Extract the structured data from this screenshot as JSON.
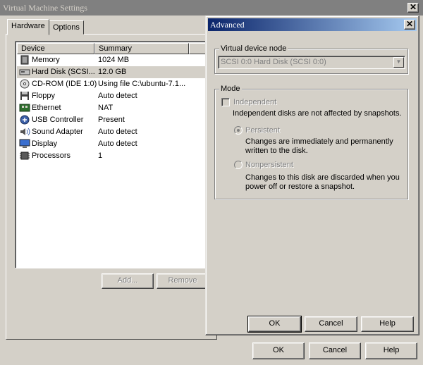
{
  "main_window": {
    "title": "Virtual Machine Settings",
    "close_glyph": "✕",
    "tabs": [
      {
        "label": "Hardware",
        "active": true
      },
      {
        "label": "Options",
        "active": false
      }
    ],
    "list": {
      "columns": [
        "Device",
        "Summary"
      ],
      "rows": [
        {
          "device": "Memory",
          "summary": "1024 MB",
          "icon": "memory-icon",
          "selected": false
        },
        {
          "device": "Hard Disk (SCSI...",
          "summary": "12.0 GB",
          "icon": "hard-disk-icon",
          "selected": true
        },
        {
          "device": "CD-ROM (IDE 1:0)",
          "summary": "Using file C:\\ubuntu-7.1...",
          "icon": "cd-rom-icon",
          "selected": false
        },
        {
          "device": "Floppy",
          "summary": "Auto detect",
          "icon": "floppy-icon",
          "selected": false
        },
        {
          "device": "Ethernet",
          "summary": "NAT",
          "icon": "ethernet-icon",
          "selected": false
        },
        {
          "device": "USB Controller",
          "summary": "Present",
          "icon": "usb-icon",
          "selected": false
        },
        {
          "device": "Sound Adapter",
          "summary": "Auto detect",
          "icon": "sound-icon",
          "selected": false
        },
        {
          "device": "Display",
          "summary": "Auto detect",
          "icon": "display-icon",
          "selected": false
        },
        {
          "device": "Processors",
          "summary": "1",
          "icon": "processor-icon",
          "selected": false
        }
      ]
    },
    "add_label": "Add...",
    "remove_label": "Remove",
    "ok_label": "OK",
    "cancel_label": "Cancel",
    "help_label": "Help"
  },
  "dialog": {
    "title": "Advanced",
    "close_glyph": "✕",
    "vdn_group": "Virtual device node",
    "vdn_value": "SCSI  0:0   Hard Disk (SCSI 0:0)",
    "mode_group": "Mode",
    "independent_label": "Independent",
    "independent_desc": "Independent disks are not affected by snapshots.",
    "persistent_label": "Persistent",
    "persistent_desc_1": "Changes are immediately and permanently",
    "persistent_desc_2": "written to the disk.",
    "nonpersistent_label": "Nonpersistent",
    "nonpersistent_desc_1": "Changes to this disk are discarded when you",
    "nonpersistent_desc_2": "power off or restore a snapshot.",
    "ok_label": "OK",
    "cancel_label": "Cancel",
    "help_label": "Help"
  },
  "colors": {
    "face": "#d4d0c8",
    "title_active_start": "#0a246a",
    "title_active_end": "#a6caf0",
    "title_inactive": "#808080",
    "disabled_text": "#808080"
  }
}
